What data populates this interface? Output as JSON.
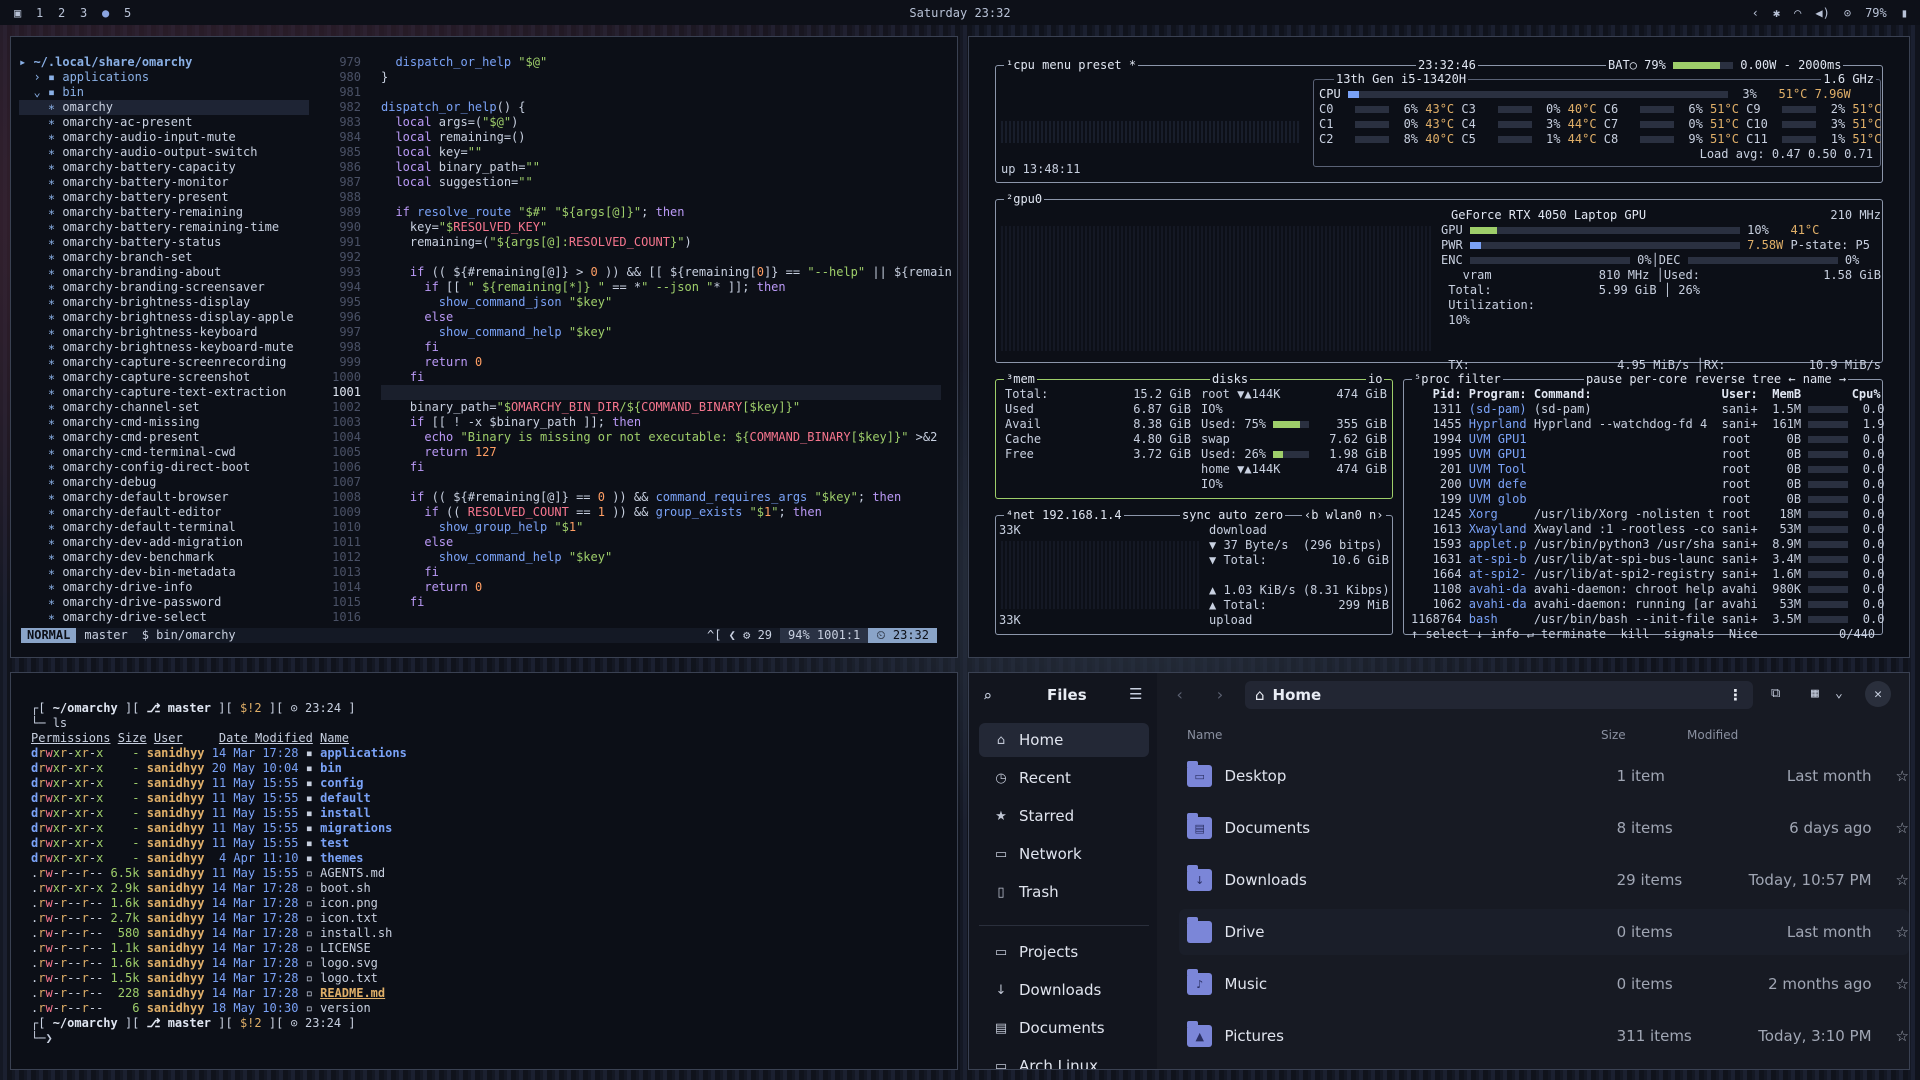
{
  "topbar": {
    "workspaces": [
      "1",
      "2",
      "3",
      "●",
      "5"
    ],
    "clock": "Saturday 23:32",
    "battery": "79%"
  },
  "editor": {
    "tree_root": "~/.local/share/omarchy",
    "tree_dirs": [
      "applications",
      "bin"
    ],
    "tree_files": [
      "omarchy",
      "omarchy-ac-present",
      "omarchy-audio-input-mute",
      "omarchy-audio-output-switch",
      "omarchy-battery-capacity",
      "omarchy-battery-monitor",
      "omarchy-battery-present",
      "omarchy-battery-remaining",
      "omarchy-battery-remaining-time",
      "omarchy-battery-status",
      "omarchy-branch-set",
      "omarchy-branding-about",
      "omarchy-branding-screensaver",
      "omarchy-brightness-display",
      "omarchy-brightness-display-apple",
      "omarchy-brightness-keyboard",
      "omarchy-brightness-keyboard-mute",
      "omarchy-capture-screenrecording",
      "omarchy-capture-screenshot",
      "omarchy-capture-text-extraction",
      "omarchy-channel-set",
      "omarchy-cmd-missing",
      "omarchy-cmd-present",
      "omarchy-cmd-terminal-cwd",
      "omarchy-config-direct-boot",
      "omarchy-debug",
      "omarchy-default-browser",
      "omarchy-default-editor",
      "omarchy-default-terminal",
      "omarchy-dev-add-migration",
      "omarchy-dev-benchmark",
      "omarchy-dev-bin-metadata",
      "omarchy-drive-info",
      "omarchy-drive-password",
      "omarchy-drive-select"
    ],
    "line_numbers": [
      "979",
      "980",
      "981",
      "982",
      "983",
      "984",
      "985",
      "986",
      "987",
      "988",
      "989",
      "990",
      "991",
      "992",
      "993",
      "994",
      "995",
      "996",
      "997",
      "998",
      "999",
      "1000",
      "1001",
      "1002",
      "1003",
      "1004",
      "1005",
      "1006",
      "1007",
      "1008",
      "1009",
      "1010",
      "1011",
      "1012",
      "1013",
      "1014",
      "1015",
      "1016"
    ],
    "code": [
      "  dispatch_or_help \"$@\"",
      "}",
      "",
      "dispatch_or_help() {",
      "  local args=(\"$@\")",
      "  local remaining=()",
      "  local key=\"\"",
      "  local binary_path=\"\"",
      "  local suggestion=\"\"",
      "",
      "  if resolve_route \"$#\" \"${args[@]}\"; then",
      "    key=\"$RESOLVED_KEY\"",
      "    remaining=(\"${args[@]:RESOLVED_COUNT}\")",
      "",
      "    if (( ${#remaining[@]} > 0 )) && [[ ${remaining[0]} == \"--help\" || ${remain",
      "      if [[ \" ${remaining[*]} \" == *\" --json \"* ]]; then",
      "        show_command_json \"$key\"",
      "      else",
      "        show_command_help \"$key\"",
      "      fi",
      "      return 0",
      "    fi",
      "",
      "    binary_path=\"$OMARCHY_BIN_DIR/${COMMAND_BINARY[$key]}\"",
      "    if [[ ! -x $binary_path ]]; then",
      "      echo \"Binary is missing or not executable: ${COMMAND_BINARY[$key]}\" >&2",
      "      return 127",
      "    fi",
      "",
      "    if (( ${#remaining[@]} == 0 )) && command_requires_args \"$key\"; then",
      "      if (( RESOLVED_COUNT == 1 )) && group_exists \"$1\"; then",
      "        show_group_help \"$1\"",
      "      else",
      "        show_command_help \"$key\"",
      "      fi",
      "      return 0",
      "    fi",
      ""
    ],
    "status": {
      "mode": "NORMAL",
      "branch": " master",
      "file": "$  bin/omarchy",
      "diag": "^[ ❮ ⚙ 29",
      "pos": "94% 1001:1",
      "time": "⏲ 23:32"
    }
  },
  "terminal": {
    "prompt1": {
      "path": "~/omarchy",
      "branch": "master",
      "status": "$!2",
      "time": "23:24"
    },
    "cmd": "ls",
    "headers": [
      "Permissions",
      "Size",
      "User",
      "Date Modified",
      "Name"
    ],
    "rows": [
      [
        "drwxr-xr-x",
        "-",
        "sanidhyy",
        "14 Mar 17:28",
        "applications",
        "d"
      ],
      [
        "drwxr-xr-x",
        "-",
        "sanidhyy",
        "20 May 10:04",
        "bin",
        "d"
      ],
      [
        "drwxr-xr-x",
        "-",
        "sanidhyy",
        "11 May 15:55",
        "config",
        "d"
      ],
      [
        "drwxr-xr-x",
        "-",
        "sanidhyy",
        "11 May 15:55",
        "default",
        "d"
      ],
      [
        "drwxr-xr-x",
        "-",
        "sanidhyy",
        "11 May 15:55",
        "install",
        "d"
      ],
      [
        "drwxr-xr-x",
        "-",
        "sanidhyy",
        "11 May 15:55",
        "migrations",
        "d"
      ],
      [
        "drwxr-xr-x",
        "-",
        "sanidhyy",
        "11 May 15:55",
        "test",
        "d"
      ],
      [
        "drwxr-xr-x",
        "-",
        "sanidhyy",
        "4 Apr 11:10",
        "themes",
        "d"
      ],
      [
        ".rw-r--r--",
        "6.5k",
        "sanidhyy",
        "11 May 15:55",
        "AGENTS.md",
        "f"
      ],
      [
        ".rwxr-xr-x",
        "2.9k",
        "sanidhyy",
        "14 Mar 17:28",
        "boot.sh",
        "f"
      ],
      [
        ".rw-r--r--",
        "1.6k",
        "sanidhyy",
        "14 Mar 17:28",
        "icon.png",
        "f"
      ],
      [
        ".rw-r--r--",
        "2.7k",
        "sanidhyy",
        "14 Mar 17:28",
        "icon.txt",
        "f"
      ],
      [
        ".rw-r--r--",
        "580",
        "sanidhyy",
        "14 Mar 17:28",
        "install.sh",
        "f"
      ],
      [
        ".rw-r--r--",
        "1.1k",
        "sanidhyy",
        "14 Mar 17:28",
        "LICENSE",
        "f"
      ],
      [
        ".rw-r--r--",
        "1.6k",
        "sanidhyy",
        "14 Mar 17:28",
        "logo.svg",
        "f"
      ],
      [
        ".rw-r--r--",
        "1.5k",
        "sanidhyy",
        "14 Mar 17:28",
        "logo.txt",
        "f"
      ],
      [
        ".rw-r--r--",
        "228",
        "sanidhyy",
        "14 Mar 17:28",
        "README.md",
        "r"
      ],
      [
        ".rw-r--r--",
        "6",
        "sanidhyy",
        "18 May 10:30",
        "version",
        "f"
      ]
    ],
    "prompt2": {
      "path": "~/omarchy",
      "branch": "master",
      "status": "$!2",
      "time": "23:24"
    }
  },
  "btop": {
    "cpu_tabs": [
      "cpu",
      "menu",
      "preset *"
    ],
    "cpu_time": "23:32:46",
    "bat": "BAT○ 79%",
    "power": "0.00W",
    "interval": "2000ms",
    "cpu_model": "13th Gen i5-13420H",
    "freq": "1.6 GHz",
    "cpu_total": {
      "label": "CPU",
      "pct": "3%",
      "temp": "51°C",
      "watt": "7.96W",
      "fill": 0.03
    },
    "cores": [
      [
        "C0",
        "6%",
        "43°C"
      ],
      [
        "C3",
        "0%",
        "40°C"
      ],
      [
        "C6",
        "6%",
        "51°C"
      ],
      [
        "C9",
        "2%",
        "51°C"
      ],
      [
        "C1",
        "0%",
        "43°C"
      ],
      [
        "C4",
        "3%",
        "44°C"
      ],
      [
        "C7",
        "0%",
        "51°C"
      ],
      [
        "C10",
        "3%",
        "51°C"
      ],
      [
        "C2",
        "8%",
        "40°C"
      ],
      [
        "C5",
        "1%",
        "44°C"
      ],
      [
        "C8",
        "9%",
        "51°C"
      ],
      [
        "C11",
        "1%",
        "51°C"
      ]
    ],
    "load": "Load avg: 0.47 0.50 0.71",
    "uptime": "up 13:48:11",
    "gpu": {
      "label": "gpu0",
      "name": "GeForce RTX 4050 Laptop GPU",
      "mhz": "210 MHz",
      "gpu_pct": "10%",
      "gpu_temp": "41°C",
      "pwr": "7.58W",
      "pstate": "P-state: P5",
      "enc": "0%",
      "dec": "0%",
      "vram": "810 MHz",
      "total": "5.99 GiB",
      "used": "1.58 GiB",
      "used_pct": "26%",
      "util": "10%",
      "tx": "4.95 MiB/s",
      "rx": "10.9 MiB/s",
      "gpu_fill": 0.1,
      "pwr_fill": 0.04
    },
    "mem": {
      "label": "mem",
      "total": "15.2 GiB",
      "used": "6.87 GiB",
      "avail": "8.38 GiB",
      "cache": "4.80 GiB",
      "free": "3.72 GiB"
    },
    "disks": {
      "label": "disks",
      "io": "io",
      "root": "root",
      "root_io": "▼▲144K",
      "root_size": "474 GiB",
      "io2": "IO%",
      "used_pct": "Used: 75%",
      "used_size": "355 GiB",
      "swap": "swap",
      "swap_size": "7.62 GiB",
      "swap_used": "Used: 26%",
      "swap_used_size": "1.98 GiB",
      "home": "home",
      "home_io": "▼▲144K",
      "home_size": "474 GiB",
      "io3": "IO%",
      "root_fill": 0.75,
      "swap_fill": 0.26
    },
    "net": {
      "label": "net",
      "ip": "192.168.1.4",
      "opts": "sync auto zero",
      "iface": "wlan0",
      "scale_top": "33K",
      "scale_bot": "33K",
      "down_label": "download",
      "down_rate": "37 Byte/s",
      "down_bits": "(296 bitps)",
      "down_total": "10.6 GiB",
      "up_rate": "1.03 KiB/s (8.31 Kibps)",
      "up_total": "299 MiB",
      "up_label": "upload"
    },
    "proc": {
      "label": "proc",
      "tabs": "filter",
      "opts": "pause per-core reverse tree ← name →",
      "headers": [
        "Pid:",
        "Program:",
        "Command:",
        "User:",
        "MemB",
        "Cpu%"
      ],
      "rows": [
        [
          "1311",
          "(sd-pam)",
          "(sd-pam)",
          "sani+",
          "1.5M",
          "0.0"
        ],
        [
          "1455",
          "Hyprland",
          "Hyprland --watchdog-fd 4",
          "sani+",
          "161M",
          "1.9"
        ],
        [
          "1994",
          "UVM GPU1",
          "",
          "root",
          "0B",
          "0.0"
        ],
        [
          "1995",
          "UVM GPU1",
          "",
          "root",
          "0B",
          "0.0"
        ],
        [
          "201",
          "UVM Tool",
          "",
          "root",
          "0B",
          "0.0"
        ],
        [
          "200",
          "UVM defe",
          "",
          "root",
          "0B",
          "0.0"
        ],
        [
          "199",
          "UVM glob",
          "",
          "root",
          "0B",
          "0.0"
        ],
        [
          "1245",
          "Xorg",
          "/usr/lib/Xorg -nolisten t",
          "root",
          "18M",
          "0.0"
        ],
        [
          "1613",
          "Xwayland",
          "Xwayland :1 -rootless -co",
          "sani+",
          "53M",
          "0.0"
        ],
        [
          "1593",
          "applet.p",
          "/usr/bin/python3 /usr/sha",
          "sani+",
          "8.9M",
          "0.0"
        ],
        [
          "1631",
          "at-spi-b",
          "/usr/lib/at-spi-bus-launc",
          "sani+",
          "3.4M",
          "0.0"
        ],
        [
          "1664",
          "at-spi2-",
          "/usr/lib/at-spi2-registry",
          "sani+",
          "1.6M",
          "0.0"
        ],
        [
          "1108",
          "avahi-da",
          "avahi-daemon: chroot help",
          "avahi",
          "980K",
          "0.0"
        ],
        [
          "1062",
          "avahi-da",
          "avahi-daemon: running [ar",
          "avahi",
          "53M",
          "0.0"
        ],
        [
          "1168764",
          "bash",
          "/usr/bin/bash --init-file",
          "sani+",
          "3.5M",
          "0.0"
        ]
      ],
      "footer": "↑ select ↓ info ↵ terminate  kill  signals  Nice",
      "count": "0/440"
    }
  },
  "files": {
    "title": "Files",
    "location": "Home",
    "sidebar": [
      [
        "Home",
        "home-icon"
      ],
      [
        "Recent",
        "clock-icon"
      ],
      [
        "Starred",
        "star-icon"
      ],
      [
        "Network",
        "network-icon"
      ],
      [
        "Trash",
        "trash-icon"
      ]
    ],
    "bookmarks": [
      [
        "Projects",
        "folder-icon"
      ],
      [
        "Downloads",
        "download-icon"
      ],
      [
        "Documents",
        "document-icon"
      ],
      [
        "Arch Linux",
        "folder-icon"
      ]
    ],
    "columns": [
      "Name",
      "Size",
      "Modified"
    ],
    "rows": [
      [
        "Desktop",
        "1 item",
        "Last month",
        "▭"
      ],
      [
        "Documents",
        "8 items",
        "6 days ago",
        "▤"
      ],
      [
        "Downloads",
        "29 items",
        "Today, 10:57 PM",
        "↓"
      ],
      [
        "Drive",
        "0 items",
        "Last month",
        ""
      ],
      [
        "Music",
        "0 items",
        "2 months ago",
        "♪"
      ],
      [
        "Pictures",
        "311 items",
        "Today, 3:10 PM",
        "▲"
      ]
    ]
  }
}
